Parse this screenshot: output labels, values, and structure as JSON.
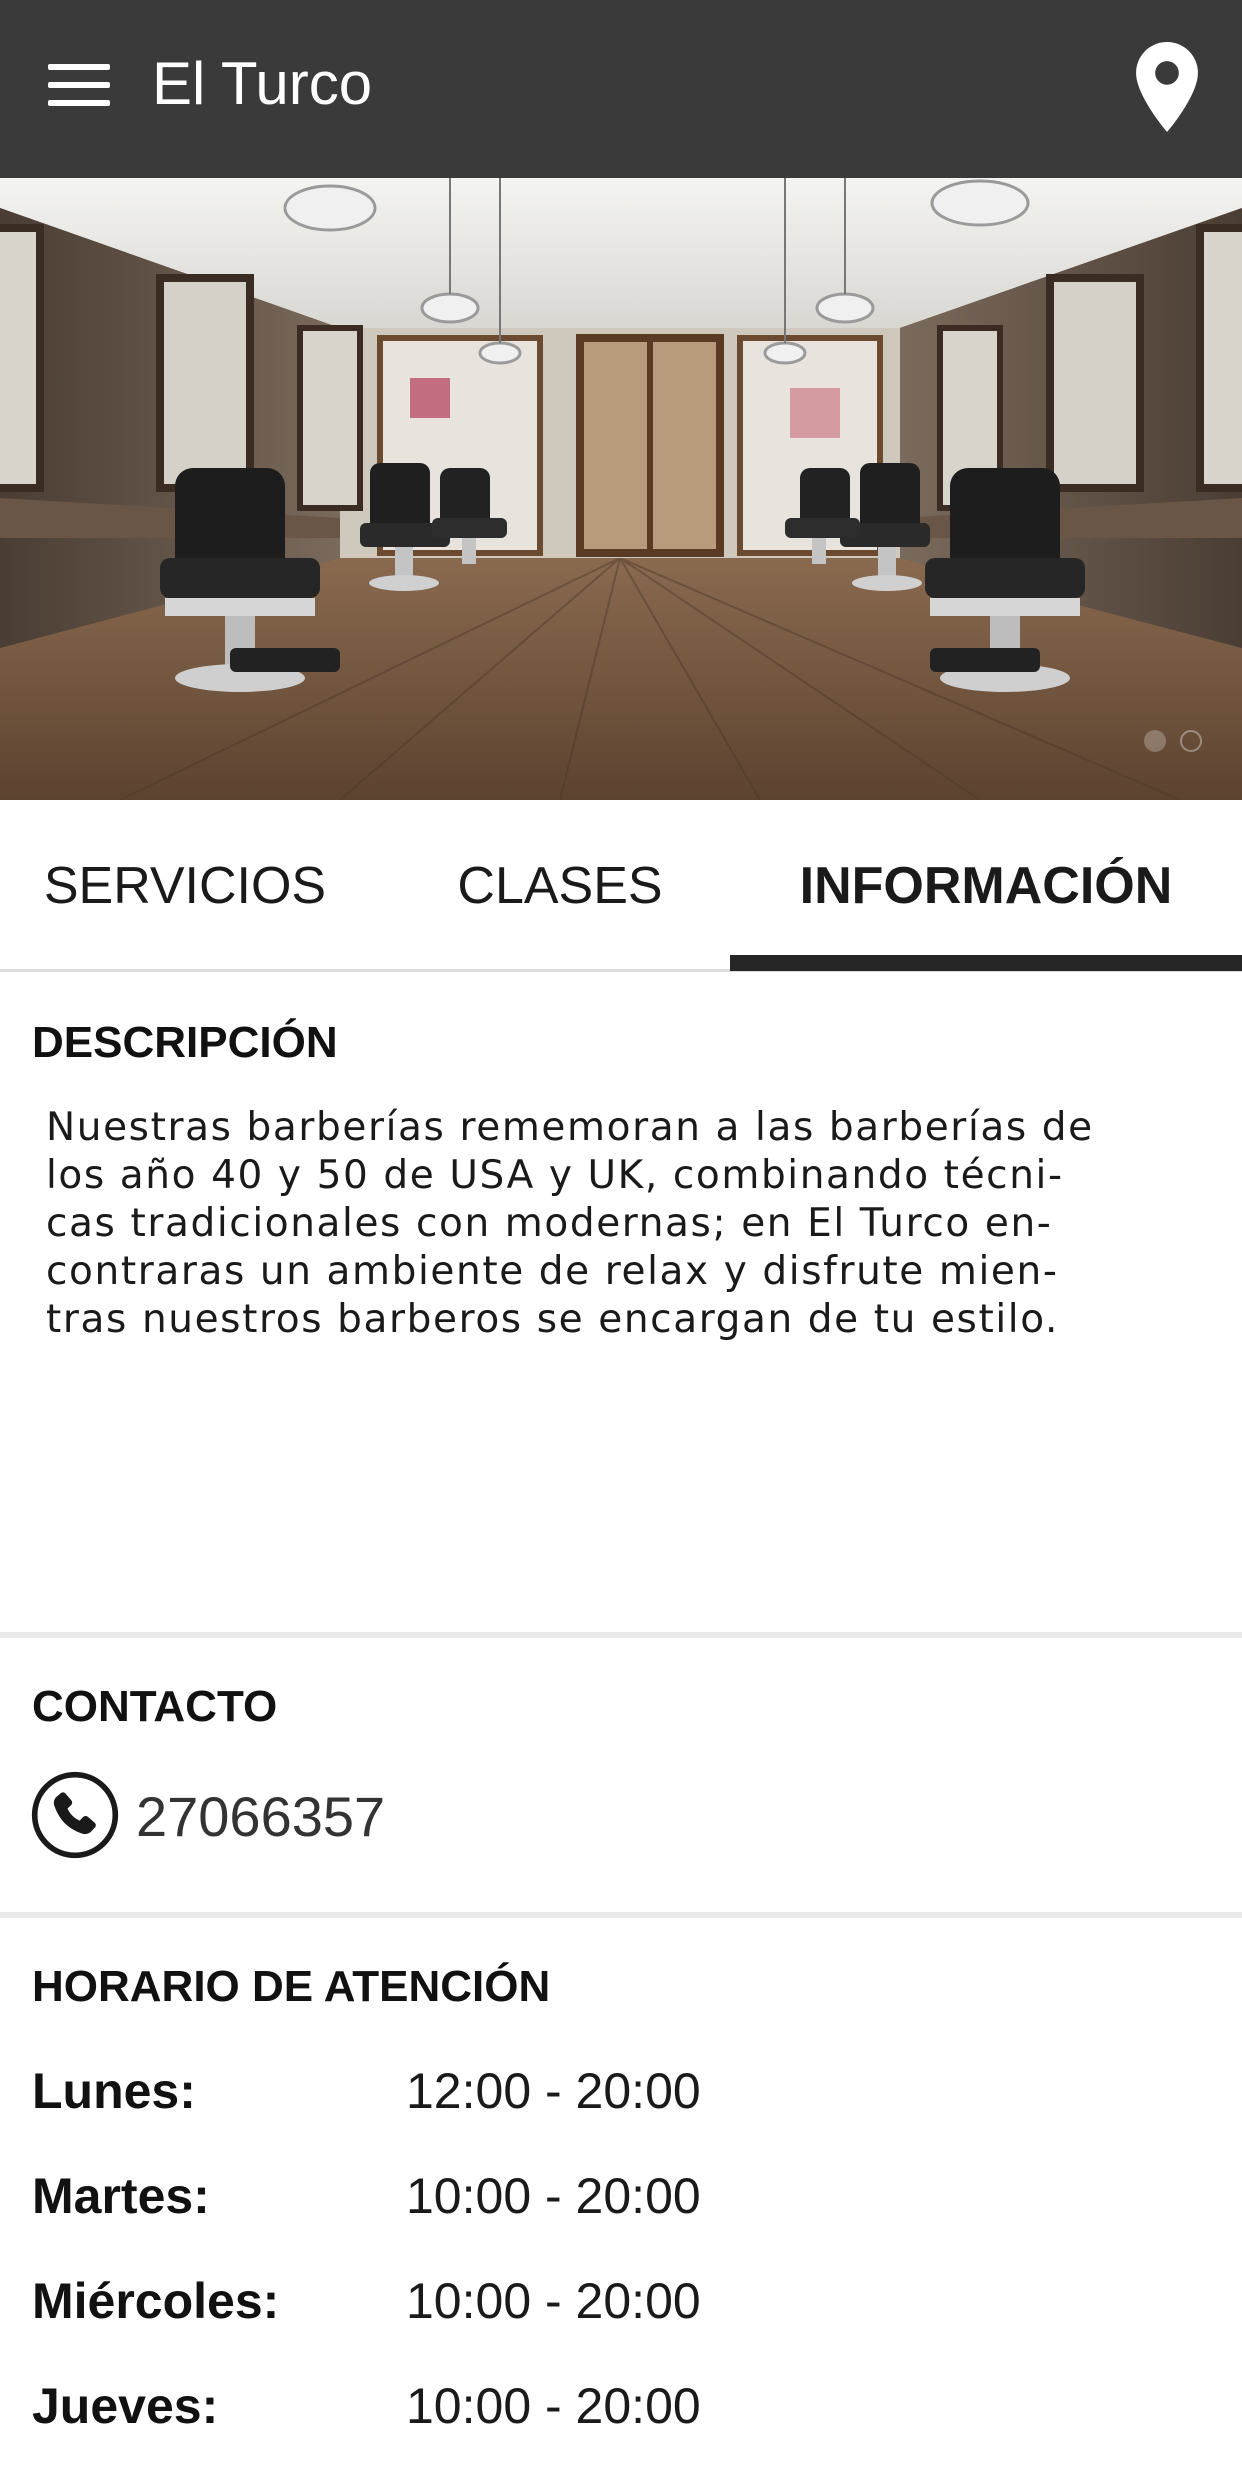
{
  "app_bar": {
    "title": "El Turco",
    "menu_icon": "hamburger-menu-icon",
    "location_icon": "map-pin-icon",
    "background": "#3a3a3a"
  },
  "hero": {
    "image": "barbershop-interior-photo",
    "carousel": {
      "slide_count": 2,
      "active_index": 0
    }
  },
  "tabs": [
    {
      "label": "SERVICIOS",
      "selected": false
    },
    {
      "label": "CLASES",
      "selected": false
    },
    {
      "label": "INFORMACIÓN",
      "selected": true
    }
  ],
  "description": {
    "title": "DESCRIPCIÓN",
    "lines": [
      "Nuestras barberías rememoran a las barberías de",
      "los año 40 y 50 de USA y UK, combinando técni-",
      "cas tradicionales con modernas; en El Turco en-",
      "contraras un ambiente de relax y disfrute mien-",
      "tras nuestros barberos se encargan de tu estilo."
    ]
  },
  "contact": {
    "title": "CONTACTO",
    "phone_icon": "phone-icon",
    "phone": "27066357"
  },
  "hours": {
    "title": "HORARIO DE ATENCIÓN",
    "rows": [
      {
        "day": "Lunes:",
        "time": "12:00 - 20:00"
      },
      {
        "day": "Martes:",
        "time": "10:00 - 20:00"
      },
      {
        "day": "Miércoles:",
        "time": "10:00 - 20:00"
      },
      {
        "day": "Jueves:",
        "time": "10:00 - 20:00"
      }
    ]
  }
}
